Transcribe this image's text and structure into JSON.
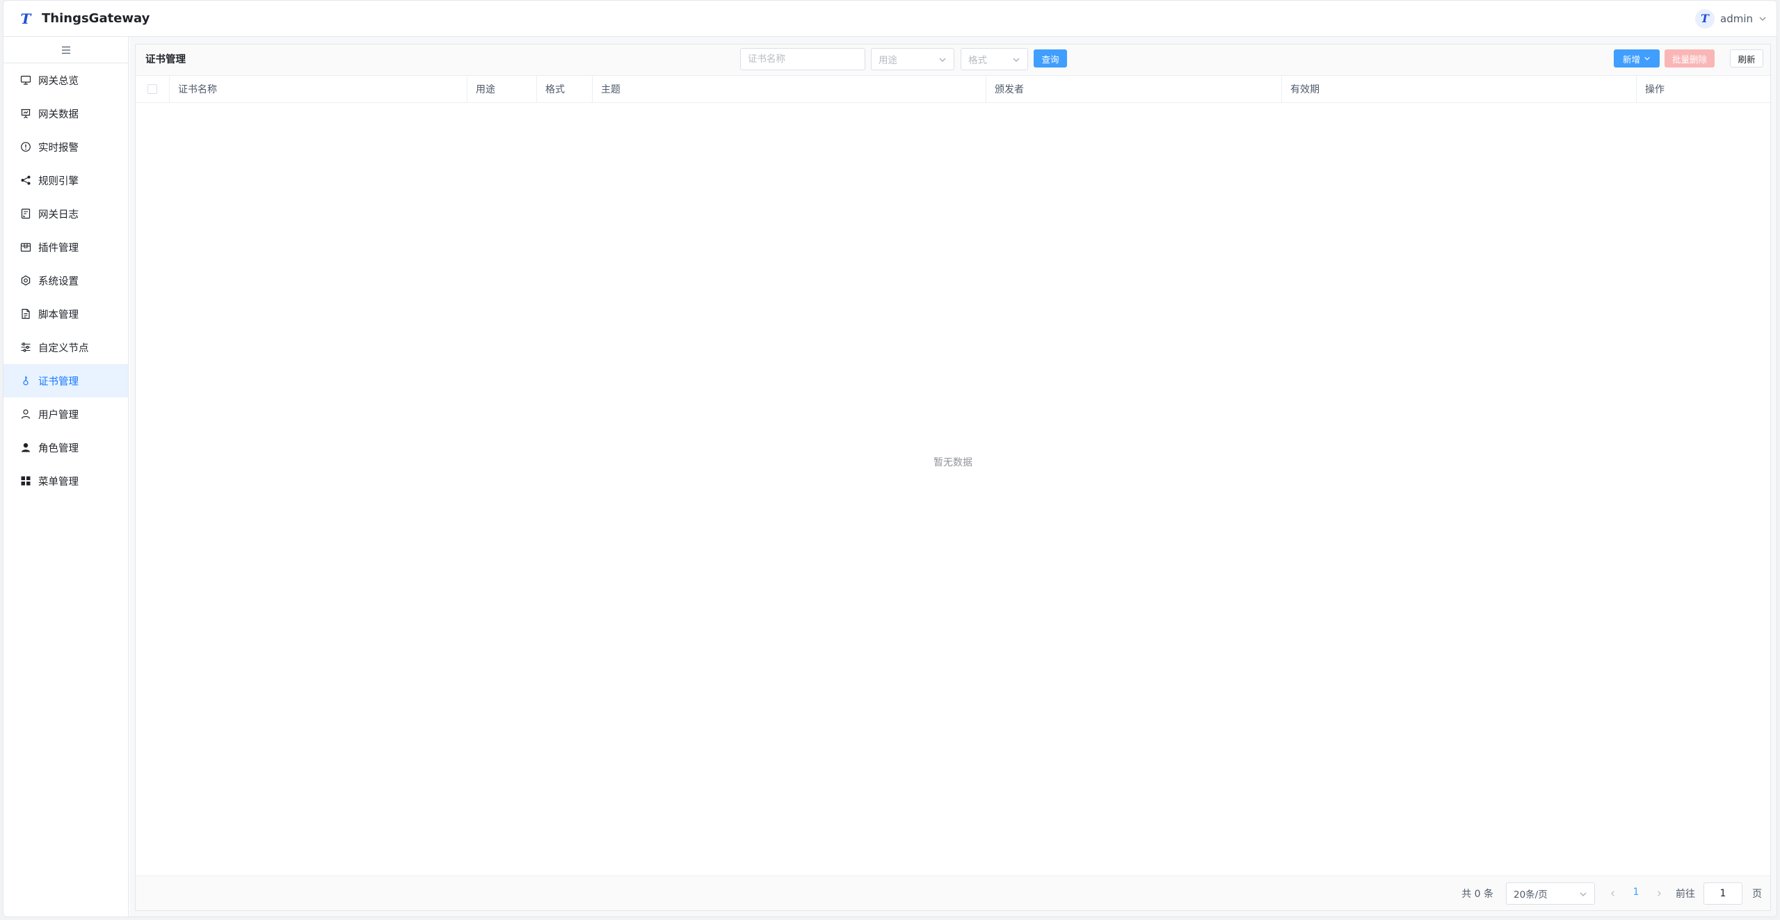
{
  "header": {
    "logo_letter": "T",
    "title": "ThingsGateway",
    "avatar_letter": "T",
    "user_name": "admin"
  },
  "sidebar": {
    "items": [
      {
        "label": "网关总览",
        "icon": "monitor-icon"
      },
      {
        "label": "网关数据",
        "icon": "presentation-icon"
      },
      {
        "label": "实时报警",
        "icon": "alert-circle-icon"
      },
      {
        "label": "规则引擎",
        "icon": "share-icon"
      },
      {
        "label": "网关日志",
        "icon": "log-document-icon"
      },
      {
        "label": "插件管理",
        "icon": "box-icon"
      },
      {
        "label": "系统设置",
        "icon": "gear-icon"
      },
      {
        "label": "脚本管理",
        "icon": "file-icon"
      },
      {
        "label": "自定义节点",
        "icon": "sliders-icon"
      },
      {
        "label": "证书管理",
        "icon": "key-icon",
        "active": true
      },
      {
        "label": "用户管理",
        "icon": "user-icon"
      },
      {
        "label": "角色管理",
        "icon": "user-filled-icon"
      },
      {
        "label": "菜单管理",
        "icon": "grid-icon"
      }
    ]
  },
  "toolbar": {
    "page_title": "证书管理",
    "search_placeholder": "证书名称",
    "usage_placeholder": "用途",
    "format_placeholder": "格式",
    "query_label": "查询",
    "add_label": "新增",
    "batch_delete_label": "批量删除",
    "refresh_label": "刷新"
  },
  "table": {
    "columns": [
      "证书名称",
      "用途",
      "格式",
      "主题",
      "颁发者",
      "有效期",
      "操作"
    ],
    "rows": [],
    "empty_text": "暂无数据"
  },
  "pagination": {
    "total_text": "共 0 条",
    "page_size": "20条/页",
    "current_page": "1",
    "goto_label": "前往",
    "goto_value": "1",
    "page_suffix": "页"
  },
  "colors": {
    "primary": "#409eff",
    "active_bg": "#e8f3ff",
    "active_text": "#1677ff",
    "danger_disabled": "#fab6b6",
    "logo": "#1e4fd6"
  }
}
